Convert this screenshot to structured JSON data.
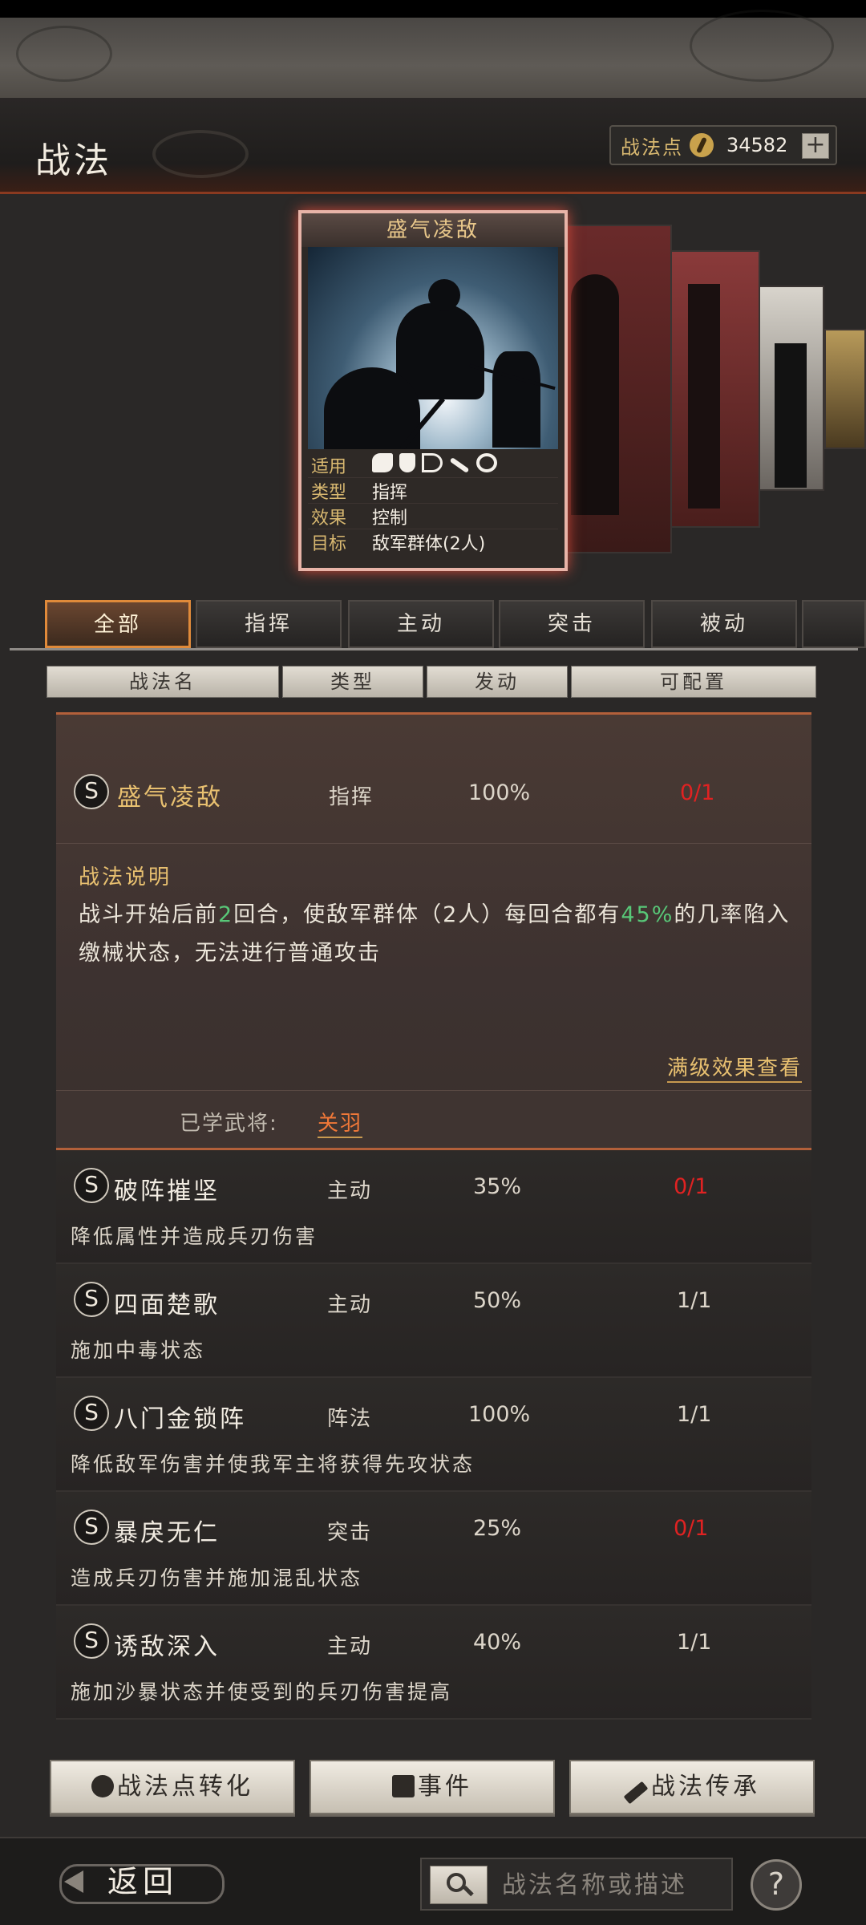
{
  "header": {
    "title": "战法",
    "points_label": "战法点",
    "points_value": "34582",
    "plus": "+"
  },
  "card": {
    "title": "盛气凌敌",
    "rows": [
      {
        "key": "适用",
        "value": ""
      },
      {
        "key": "类型",
        "value": "指挥"
      },
      {
        "key": "效果",
        "value": "控制"
      },
      {
        "key": "目标",
        "value": "敌军群体(2人)"
      }
    ],
    "unit_icons": [
      "cavalry-icon",
      "shield-icon",
      "bow-icon",
      "spear-icon",
      "wheel-icon"
    ]
  },
  "tabs": [
    "全部",
    "指挥",
    "主动",
    "突击",
    "被动"
  ],
  "active_tab": "全部",
  "columns": [
    "战法名",
    "类型",
    "发动",
    "可配置"
  ],
  "expanded": {
    "badge": "S",
    "name": "盛气凌敌",
    "type": "指挥",
    "rate": "100%",
    "config": "0/1",
    "desc_title": "战法说明",
    "desc_parts": [
      "战斗开始后前",
      "2",
      "回合，使敌军群体（2人）每回合都有",
      "45%",
      "的几率陷入缴械状态，无法进行普通攻击"
    ],
    "max_link": "满级效果查看",
    "learned_label": "已学武将:",
    "learned_value": "关羽"
  },
  "items": [
    {
      "badge": "S",
      "name": "破阵摧坚",
      "type": "主动",
      "rate": "35%",
      "config": "0/1",
      "config_red": true,
      "desc": "降低属性并造成兵刃伤害"
    },
    {
      "badge": "S",
      "name": "四面楚歌",
      "type": "主动",
      "rate": "50%",
      "config": "1/1",
      "config_red": false,
      "desc": "施加中毒状态"
    },
    {
      "badge": "S",
      "name": "八门金锁阵",
      "type": "阵法",
      "rate": "100%",
      "config": "1/1",
      "config_red": false,
      "desc": "降低敌军伤害并使我军主将获得先攻状态"
    },
    {
      "badge": "S",
      "name": "暴戾无仁",
      "type": "突击",
      "rate": "25%",
      "config": "0/1",
      "config_red": true,
      "desc": "造成兵刃伤害并施加混乱状态"
    },
    {
      "badge": "S",
      "name": "诱敌深入",
      "type": "主动",
      "rate": "40%",
      "config": "1/1",
      "config_red": false,
      "desc": "施加沙暴状态并使受到的兵刃伤害提高"
    }
  ],
  "buttons": {
    "convert": "战法点转化",
    "event": "事件",
    "inherit": "战法传承"
  },
  "footer": {
    "back": "返回",
    "search_placeholder": "战法名称或描述",
    "help": "?"
  },
  "colors": {
    "accent_orange": "#e08a3a",
    "config_red": "#e02222",
    "highlight_green": "#58c878",
    "gold_text": "#e8c070"
  }
}
